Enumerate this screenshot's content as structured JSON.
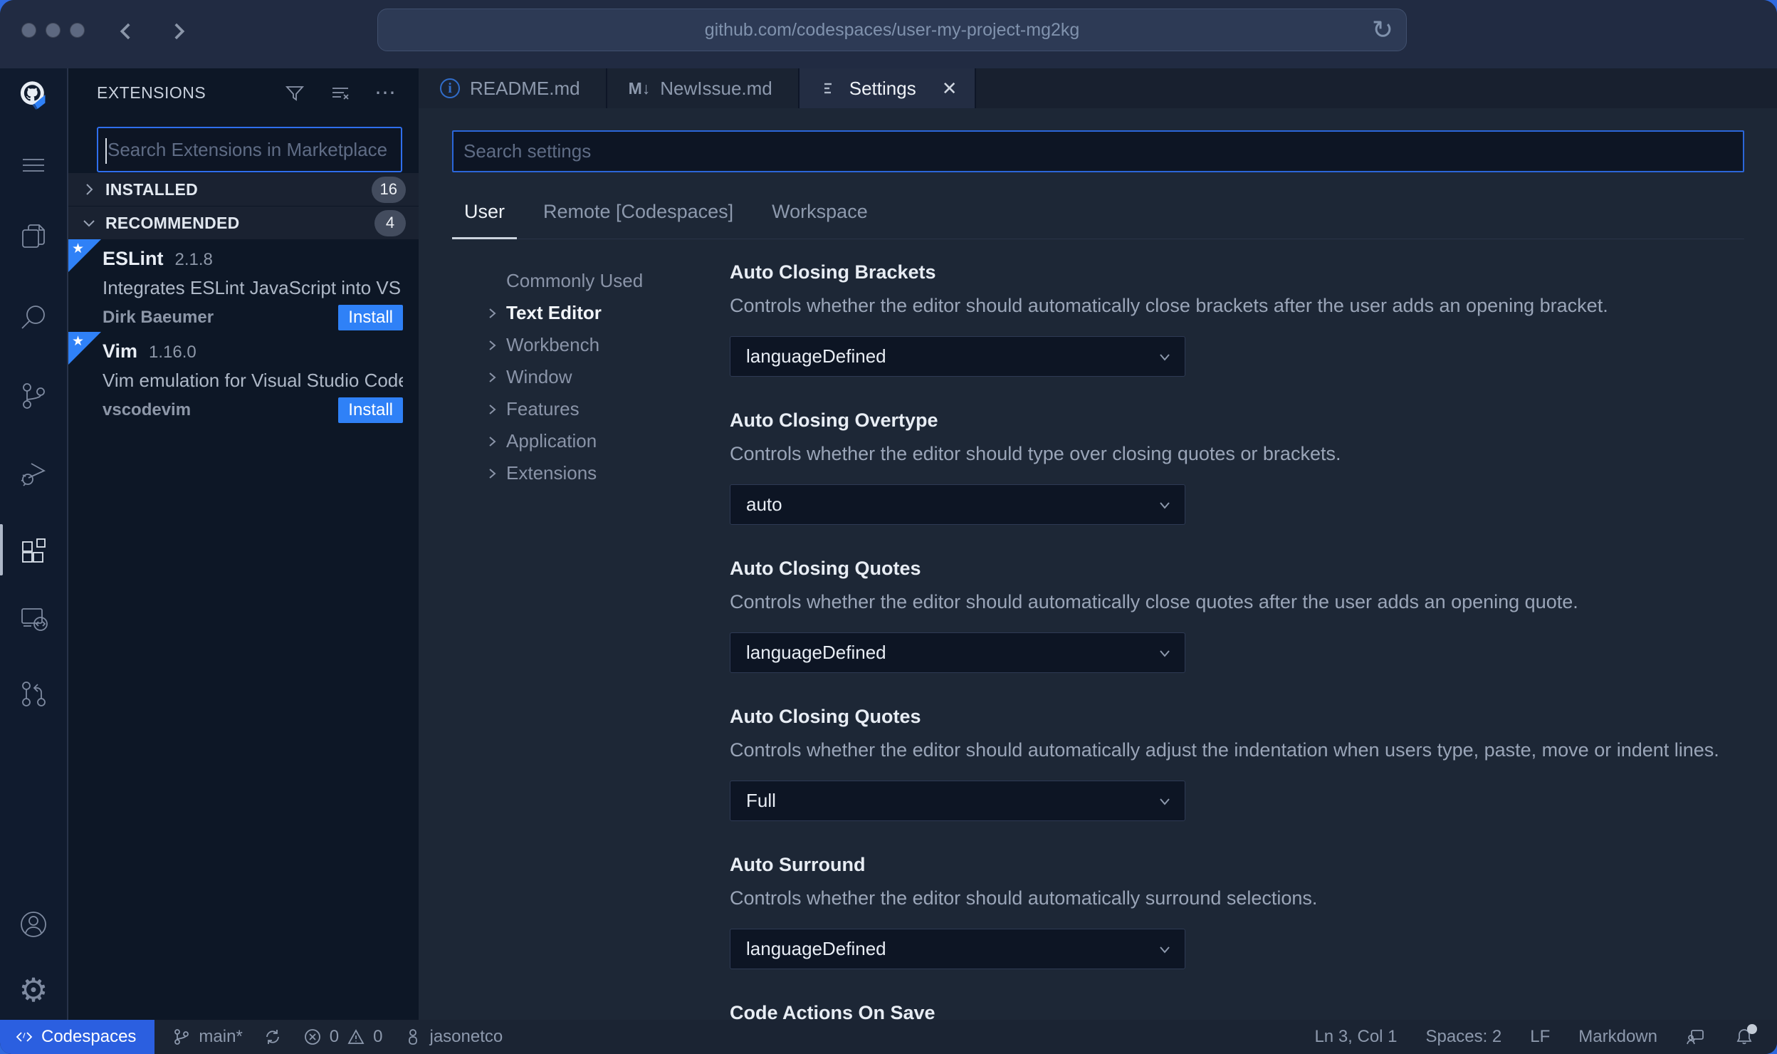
{
  "browser": {
    "url": "github.com/codespaces/user-my-project-mg2kg"
  },
  "icons": {
    "ellipsis": "⋯",
    "reload": "↻",
    "close": "✕",
    "markdown_glyph": "M↓",
    "info_glyph": "i",
    "gear_glyph": "⚙",
    "ribbon_star": "★"
  },
  "colors": {
    "accent_blue": "#2f81f7",
    "focus_border_blue": "#2b66d9",
    "codespaces_blue": "#2b5fe0",
    "badge_gray": "#434c5e",
    "editor_bg": "#1d2736",
    "panel_bg": "#0d1726",
    "desktop_bg": "#2f6ae0"
  },
  "extensions_panel": {
    "title": "EXTENSIONS",
    "search_placeholder": "Search Extensions in Marketplace",
    "sections": [
      {
        "label": "INSTALLED",
        "count": "16"
      },
      {
        "label": "RECOMMENDED",
        "count": "4"
      }
    ],
    "items": [
      {
        "name": "ESLint",
        "version": "2.1.8",
        "description": "Integrates ESLint JavaScript into VS C...",
        "author": "Dirk Baeumer",
        "action": "Install"
      },
      {
        "name": "Vim",
        "version": "1.16.0",
        "description": "Vim emulation for Visual Studio Code...",
        "author": "vscodevim",
        "action": "Install"
      }
    ]
  },
  "tabs": [
    {
      "label": "README.md"
    },
    {
      "label": "NewIssue.md"
    },
    {
      "label": "Settings"
    }
  ],
  "settings": {
    "search_placeholder": "Search settings",
    "scopes": [
      {
        "label": "User"
      },
      {
        "label": "Remote [Codespaces]"
      },
      {
        "label": "Workspace"
      }
    ],
    "toc": [
      {
        "label": "Commonly Used"
      },
      {
        "label": "Text Editor"
      },
      {
        "label": "Workbench"
      },
      {
        "label": "Window"
      },
      {
        "label": "Features"
      },
      {
        "label": "Application"
      },
      {
        "label": "Extensions"
      }
    ],
    "items": [
      {
        "title": "Auto Closing Brackets",
        "description": "Controls whether the editor should automatically close brackets after the user adds an opening bracket.",
        "value": "languageDefined"
      },
      {
        "title": "Auto Closing Overtype",
        "description": "Controls whether the editor should type over closing quotes or brackets.",
        "value": "auto"
      },
      {
        "title": "Auto Closing Quotes",
        "description": "Controls whether the editor should automatically close quotes after the user adds an opening quote.",
        "value": "languageDefined"
      },
      {
        "title": "Auto Closing Quotes",
        "description": "Controls whether the editor should automatically adjust the indentation when users type, paste, move or indent lines.",
        "value": "Full"
      },
      {
        "title": "Auto Surround",
        "description": "Controls whether the editor should automatically surround selections.",
        "value": "languageDefined"
      },
      {
        "title": "Code Actions On Save"
      }
    ]
  },
  "status_bar": {
    "codespaces_label": "Codespaces",
    "branch": "main*",
    "errors": "0",
    "warnings": "0",
    "user": "jasonetco",
    "cursor": "Ln 3, Col 1",
    "indentation": "Spaces: 2",
    "eol": "LF",
    "language": "Markdown"
  }
}
